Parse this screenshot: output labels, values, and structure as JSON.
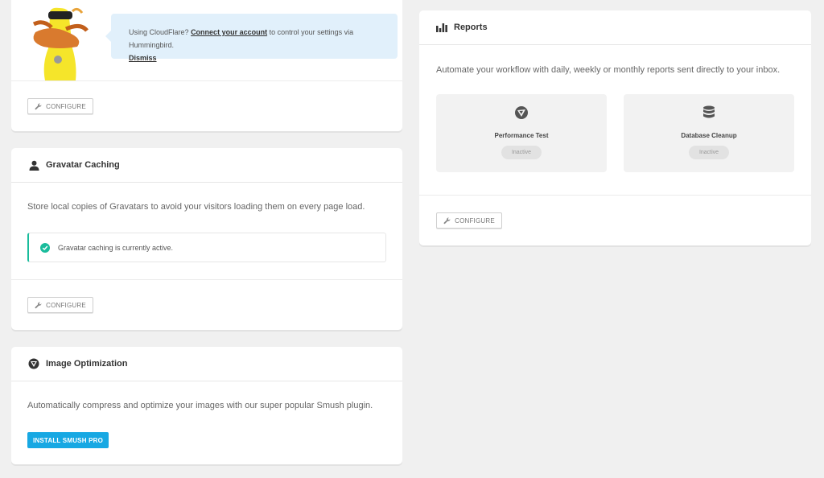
{
  "cloudflare": {
    "notice_prefix": "Using CloudFlare?",
    "connect_link": "Connect your account",
    "notice_suffix": "to control your settings via Hummingbird.",
    "dismiss_link": "Dismiss",
    "configure_label": "CONFIGURE"
  },
  "gravatar": {
    "title": "Gravatar Caching",
    "description": "Store local copies of Gravatars to avoid your visitors loading them on every page load.",
    "status_message": "Gravatar caching is currently active.",
    "configure_label": "CONFIGURE"
  },
  "image_optimization": {
    "title": "Image Optimization",
    "description": "Automatically compress and optimize your images with our super popular Smush plugin.",
    "install_label": "INSTALL SMUSH PRO"
  },
  "reports": {
    "title": "Reports",
    "description": "Automate your workflow with daily, weekly or monthly reports sent directly to your inbox.",
    "items": [
      {
        "label": "Performance Test",
        "status": "Inactive",
        "icon": "performance-icon"
      },
      {
        "label": "Database Cleanup",
        "status": "Inactive",
        "icon": "database-icon"
      }
    ],
    "configure_label": "CONFIGURE"
  },
  "colors": {
    "accent": "#17a8e3",
    "success": "#1abc9c",
    "notice_bg": "#e1f0fb"
  }
}
